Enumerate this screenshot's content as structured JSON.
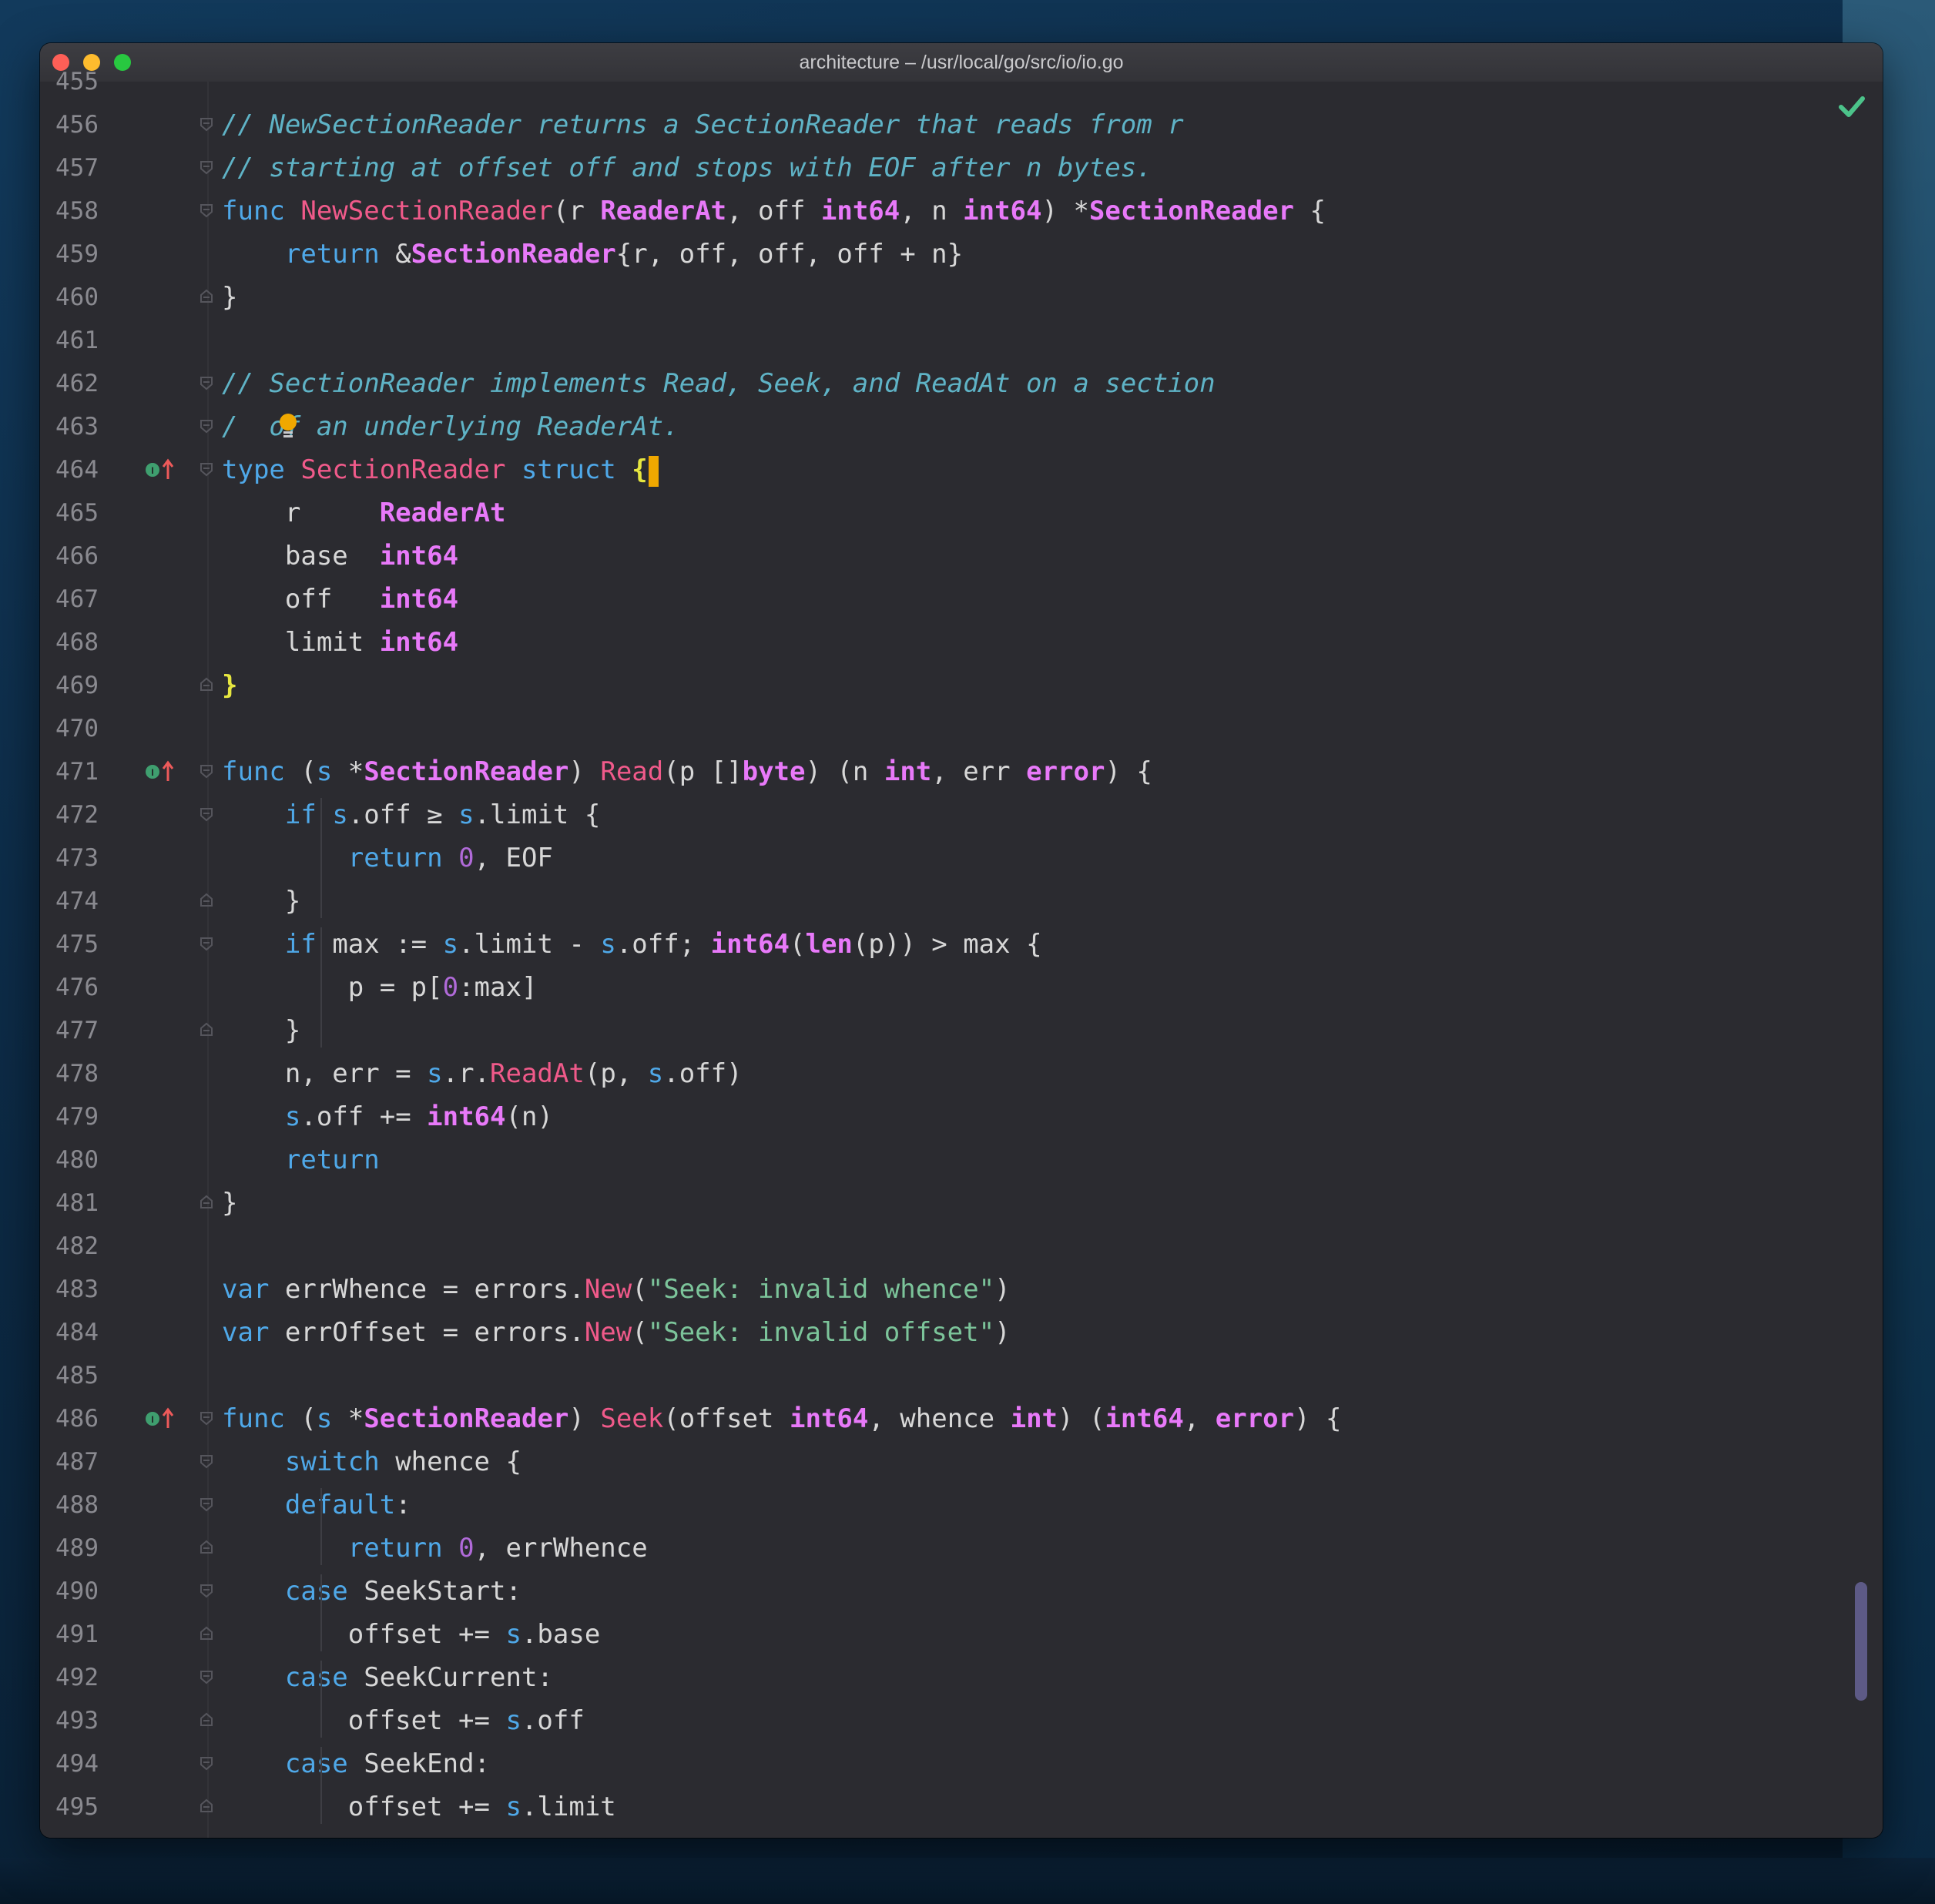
{
  "window": {
    "title": "architecture – /usr/local/go/src/io/io.go"
  },
  "colors": {
    "comment": "#5fb3c6",
    "keyword": "#4fa8e8",
    "function": "#f05a8a",
    "type": "#e879f9",
    "string": "#7cc49a",
    "number": "#b06ad8",
    "brace_match": "#e6e640",
    "caret": "#f0a800",
    "background": "#2b2b30"
  },
  "icons": {
    "inspection_status": "check-icon",
    "intention": "bulb-icon",
    "implements_marker": "implements-marker-icon"
  },
  "editor": {
    "top_partial_line": "455",
    "lines": [
      {
        "num": "456",
        "tokens": [
          {
            "t": "// NewSectionReader returns a SectionReader that reads from r",
            "c": "comment"
          }
        ]
      },
      {
        "num": "457",
        "tokens": [
          {
            "t": "// starting at offset off and stops with EOF after n bytes.",
            "c": "comment"
          }
        ]
      },
      {
        "num": "458",
        "tokens": [
          {
            "t": "func ",
            "c": "kw"
          },
          {
            "t": "NewSectionReader",
            "c": "fn"
          },
          {
            "t": "(r ",
            "c": "plain"
          },
          {
            "t": "ReaderAt",
            "c": "type"
          },
          {
            "t": ", off ",
            "c": "plain"
          },
          {
            "t": "int64",
            "c": "type"
          },
          {
            "t": ", n ",
            "c": "plain"
          },
          {
            "t": "int64",
            "c": "type"
          },
          {
            "t": ") *",
            "c": "plain"
          },
          {
            "t": "SectionReader",
            "c": "type"
          },
          {
            "t": " {",
            "c": "plain"
          }
        ]
      },
      {
        "num": "459",
        "tokens": [
          {
            "t": "    ",
            "c": "plain"
          },
          {
            "t": "return ",
            "c": "kw"
          },
          {
            "t": "&",
            "c": "plain"
          },
          {
            "t": "SectionReader",
            "c": "type"
          },
          {
            "t": "{r, off, off, off + n}",
            "c": "plain"
          }
        ]
      },
      {
        "num": "460",
        "tokens": [
          {
            "t": "}",
            "c": "plain"
          }
        ]
      },
      {
        "num": "461",
        "tokens": []
      },
      {
        "num": "462",
        "tokens": [
          {
            "t": "// SectionReader implements Read, Seek, and ReadAt on a section",
            "c": "comment"
          }
        ]
      },
      {
        "num": "463",
        "tokens": [
          {
            "t": "/  of an underlying ReaderAt.",
            "c": "comment"
          }
        ]
      },
      {
        "num": "464",
        "tokens": [
          {
            "t": "type ",
            "c": "kw"
          },
          {
            "t": "SectionReader ",
            "c": "fn"
          },
          {
            "t": "struct ",
            "c": "kw"
          },
          {
            "t": "{",
            "c": "brace"
          }
        ]
      },
      {
        "num": "465",
        "tokens": [
          {
            "t": "    r     ",
            "c": "plain"
          },
          {
            "t": "ReaderAt",
            "c": "type"
          }
        ]
      },
      {
        "num": "466",
        "tokens": [
          {
            "t": "    base  ",
            "c": "plain"
          },
          {
            "t": "int64",
            "c": "type"
          }
        ]
      },
      {
        "num": "467",
        "tokens": [
          {
            "t": "    off   ",
            "c": "plain"
          },
          {
            "t": "int64",
            "c": "type"
          }
        ]
      },
      {
        "num": "468",
        "tokens": [
          {
            "t": "    limit ",
            "c": "plain"
          },
          {
            "t": "int64",
            "c": "type"
          }
        ]
      },
      {
        "num": "469",
        "tokens": [
          {
            "t": "}",
            "c": "brace"
          }
        ]
      },
      {
        "num": "470",
        "tokens": []
      },
      {
        "num": "471",
        "tokens": [
          {
            "t": "func ",
            "c": "kw"
          },
          {
            "t": "(",
            "c": "plain"
          },
          {
            "t": "s",
            "c": "kw"
          },
          {
            "t": " *",
            "c": "plain"
          },
          {
            "t": "SectionReader",
            "c": "type"
          },
          {
            "t": ") ",
            "c": "plain"
          },
          {
            "t": "Read",
            "c": "fn"
          },
          {
            "t": "(p []",
            "c": "plain"
          },
          {
            "t": "byte",
            "c": "type"
          },
          {
            "t": ") (n ",
            "c": "plain"
          },
          {
            "t": "int",
            "c": "type"
          },
          {
            "t": ", err ",
            "c": "plain"
          },
          {
            "t": "error",
            "c": "type"
          },
          {
            "t": ") {",
            "c": "plain"
          }
        ]
      },
      {
        "num": "472",
        "tokens": [
          {
            "t": "    ",
            "c": "plain"
          },
          {
            "t": "if ",
            "c": "kw"
          },
          {
            "t": "s",
            "c": "kw"
          },
          {
            "t": ".off ≥ ",
            "c": "plain"
          },
          {
            "t": "s",
            "c": "kw"
          },
          {
            "t": ".limit {",
            "c": "plain"
          }
        ]
      },
      {
        "num": "473",
        "tokens": [
          {
            "t": "        ",
            "c": "plain"
          },
          {
            "t": "return ",
            "c": "kw"
          },
          {
            "t": "0",
            "c": "num"
          },
          {
            "t": ", EOF",
            "c": "plain"
          }
        ]
      },
      {
        "num": "474",
        "tokens": [
          {
            "t": "    }",
            "c": "plain"
          }
        ]
      },
      {
        "num": "475",
        "tokens": [
          {
            "t": "    ",
            "c": "plain"
          },
          {
            "t": "if ",
            "c": "kw"
          },
          {
            "t": "max := ",
            "c": "plain"
          },
          {
            "t": "s",
            "c": "kw"
          },
          {
            "t": ".limit - ",
            "c": "plain"
          },
          {
            "t": "s",
            "c": "kw"
          },
          {
            "t": ".off; ",
            "c": "plain"
          },
          {
            "t": "int64",
            "c": "type"
          },
          {
            "t": "(",
            "c": "plain"
          },
          {
            "t": "len",
            "c": "type"
          },
          {
            "t": "(p)) > max {",
            "c": "plain"
          }
        ]
      },
      {
        "num": "476",
        "tokens": [
          {
            "t": "        p = p[",
            "c": "plain"
          },
          {
            "t": "0",
            "c": "num"
          },
          {
            "t": ":max]",
            "c": "plain"
          }
        ]
      },
      {
        "num": "477",
        "tokens": [
          {
            "t": "    }",
            "c": "plain"
          }
        ]
      },
      {
        "num": "478",
        "tokens": [
          {
            "t": "    n, err = ",
            "c": "plain"
          },
          {
            "t": "s",
            "c": "kw"
          },
          {
            "t": ".r.",
            "c": "plain"
          },
          {
            "t": "ReadAt",
            "c": "fn"
          },
          {
            "t": "(p, ",
            "c": "plain"
          },
          {
            "t": "s",
            "c": "kw"
          },
          {
            "t": ".off)",
            "c": "plain"
          }
        ]
      },
      {
        "num": "479",
        "tokens": [
          {
            "t": "    ",
            "c": "plain"
          },
          {
            "t": "s",
            "c": "kw"
          },
          {
            "t": ".off += ",
            "c": "plain"
          },
          {
            "t": "int64",
            "c": "type"
          },
          {
            "t": "(n)",
            "c": "plain"
          }
        ]
      },
      {
        "num": "480",
        "tokens": [
          {
            "t": "    ",
            "c": "plain"
          },
          {
            "t": "return",
            "c": "kw"
          }
        ]
      },
      {
        "num": "481",
        "tokens": [
          {
            "t": "}",
            "c": "plain"
          }
        ]
      },
      {
        "num": "482",
        "tokens": []
      },
      {
        "num": "483",
        "tokens": [
          {
            "t": "var ",
            "c": "kw"
          },
          {
            "t": "errWhence = errors.",
            "c": "plain"
          },
          {
            "t": "New",
            "c": "fn"
          },
          {
            "t": "(",
            "c": "plain"
          },
          {
            "t": "\"Seek: invalid whence\"",
            "c": "str"
          },
          {
            "t": ")",
            "c": "plain"
          }
        ]
      },
      {
        "num": "484",
        "tokens": [
          {
            "t": "var ",
            "c": "kw"
          },
          {
            "t": "errOffset = errors.",
            "c": "plain"
          },
          {
            "t": "New",
            "c": "fn"
          },
          {
            "t": "(",
            "c": "plain"
          },
          {
            "t": "\"Seek: invalid offset\"",
            "c": "str"
          },
          {
            "t": ")",
            "c": "plain"
          }
        ]
      },
      {
        "num": "485",
        "tokens": []
      },
      {
        "num": "486",
        "tokens": [
          {
            "t": "func ",
            "c": "kw"
          },
          {
            "t": "(",
            "c": "plain"
          },
          {
            "t": "s",
            "c": "kw"
          },
          {
            "t": " *",
            "c": "plain"
          },
          {
            "t": "SectionReader",
            "c": "type"
          },
          {
            "t": ") ",
            "c": "plain"
          },
          {
            "t": "Seek",
            "c": "fn"
          },
          {
            "t": "(offset ",
            "c": "plain"
          },
          {
            "t": "int64",
            "c": "type"
          },
          {
            "t": ", whence ",
            "c": "plain"
          },
          {
            "t": "int",
            "c": "type"
          },
          {
            "t": ") (",
            "c": "plain"
          },
          {
            "t": "int64",
            "c": "type"
          },
          {
            "t": ", ",
            "c": "plain"
          },
          {
            "t": "error",
            "c": "type"
          },
          {
            "t": ") {",
            "c": "plain"
          }
        ]
      },
      {
        "num": "487",
        "tokens": [
          {
            "t": "    ",
            "c": "plain"
          },
          {
            "t": "switch ",
            "c": "kw"
          },
          {
            "t": "whence {",
            "c": "plain"
          }
        ]
      },
      {
        "num": "488",
        "tokens": [
          {
            "t": "    ",
            "c": "plain"
          },
          {
            "t": "default",
            "c": "kw"
          },
          {
            "t": ":",
            "c": "plain"
          }
        ]
      },
      {
        "num": "489",
        "tokens": [
          {
            "t": "        ",
            "c": "plain"
          },
          {
            "t": "return ",
            "c": "kw"
          },
          {
            "t": "0",
            "c": "num"
          },
          {
            "t": ", errWhence",
            "c": "plain"
          }
        ]
      },
      {
        "num": "490",
        "tokens": [
          {
            "t": "    ",
            "c": "plain"
          },
          {
            "t": "case ",
            "c": "kw"
          },
          {
            "t": "SeekStart:",
            "c": "plain"
          }
        ]
      },
      {
        "num": "491",
        "tokens": [
          {
            "t": "        offset += ",
            "c": "plain"
          },
          {
            "t": "s",
            "c": "kw"
          },
          {
            "t": ".base",
            "c": "plain"
          }
        ]
      },
      {
        "num": "492",
        "tokens": [
          {
            "t": "    ",
            "c": "plain"
          },
          {
            "t": "case ",
            "c": "kw"
          },
          {
            "t": "SeekCurrent:",
            "c": "plain"
          }
        ]
      },
      {
        "num": "493",
        "tokens": [
          {
            "t": "        offset += ",
            "c": "plain"
          },
          {
            "t": "s",
            "c": "kw"
          },
          {
            "t": ".off",
            "c": "plain"
          }
        ]
      },
      {
        "num": "494",
        "tokens": [
          {
            "t": "    ",
            "c": "plain"
          },
          {
            "t": "case ",
            "c": "kw"
          },
          {
            "t": "SeekEnd:",
            "c": "plain"
          }
        ]
      },
      {
        "num": "495",
        "tokens": [
          {
            "t": "        offset += ",
            "c": "plain"
          },
          {
            "t": "s",
            "c": "kw"
          },
          {
            "t": ".limit",
            "c": "plain"
          }
        ]
      }
    ]
  }
}
